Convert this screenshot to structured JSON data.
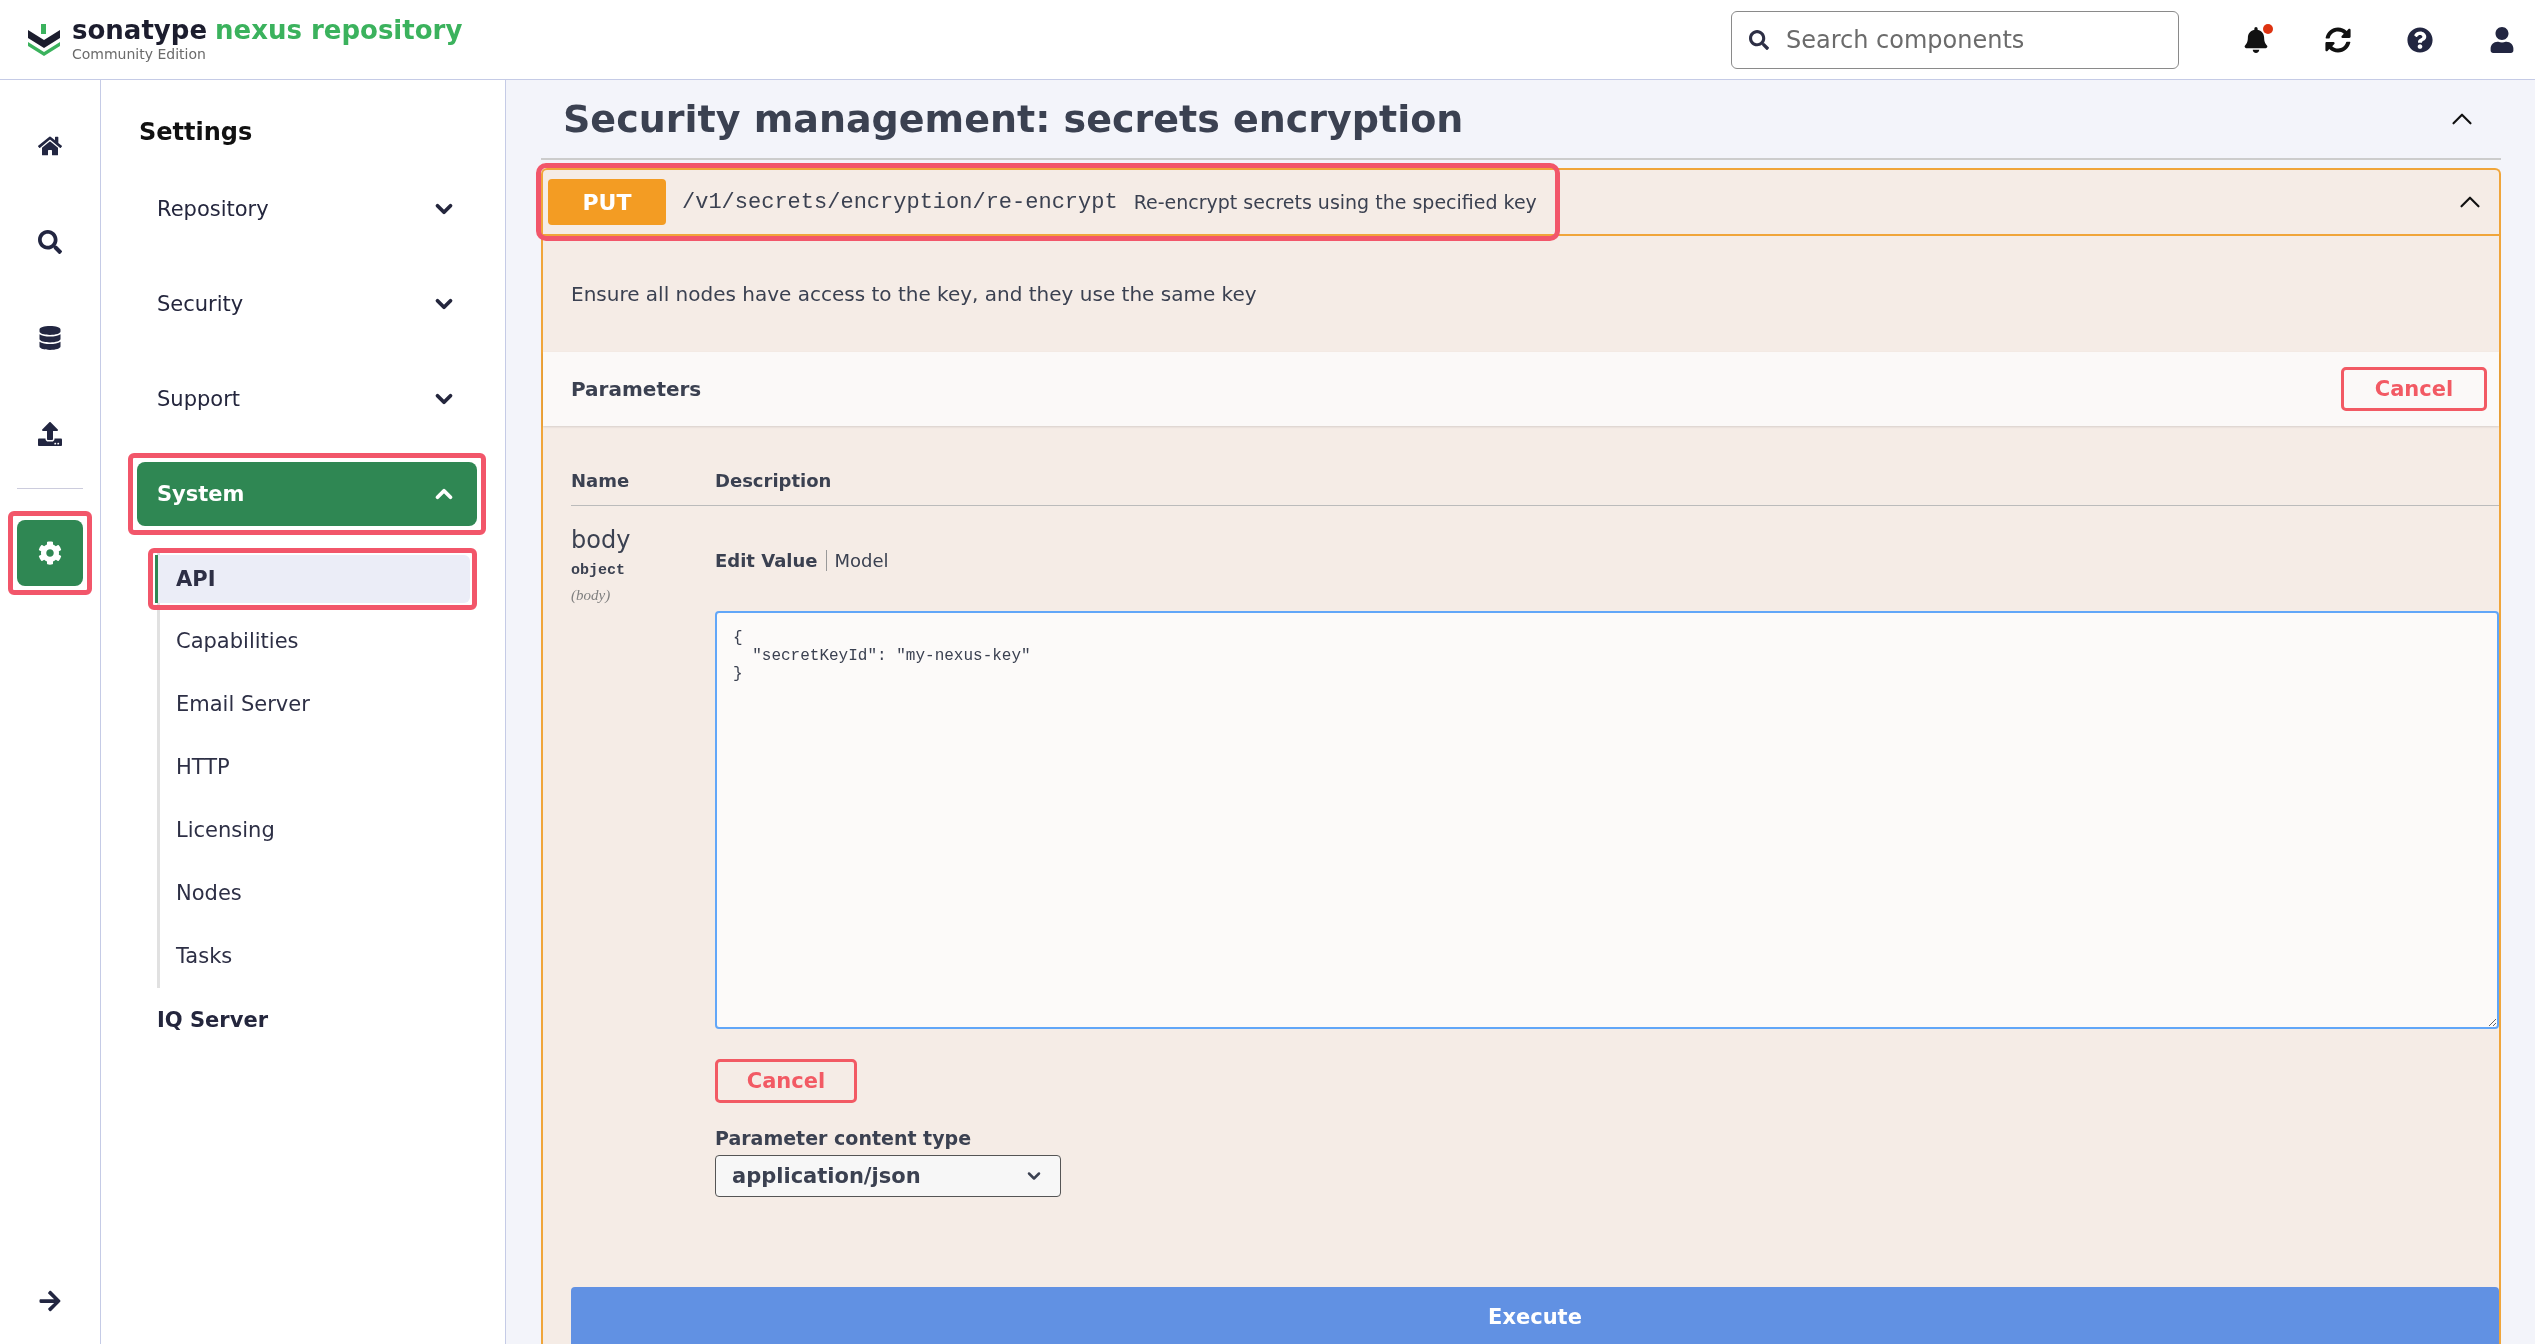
{
  "header": {
    "brand": "sonatype",
    "product": "nexus repository",
    "edition": "Community Edition",
    "search": {
      "placeholder": "Search components"
    },
    "notification_dot": true
  },
  "rail": [
    {
      "kind": "home",
      "selected": false,
      "highlighted": false
    },
    {
      "kind": "search",
      "selected": false,
      "highlighted": false
    },
    {
      "kind": "database",
      "selected": false,
      "highlighted": false
    },
    {
      "kind": "upload",
      "selected": false,
      "highlighted": false
    },
    {
      "kind": "settings",
      "selected": true,
      "highlighted": true
    }
  ],
  "sidebar": {
    "title": "Settings",
    "sections": [
      {
        "kind": "group",
        "label": "Repository",
        "expanded": false,
        "selected": false,
        "highlighted": false
      },
      {
        "kind": "group",
        "label": "Security",
        "expanded": false,
        "selected": false,
        "highlighted": false
      },
      {
        "kind": "group",
        "label": "Support",
        "expanded": false,
        "selected": false,
        "highlighted": false
      },
      {
        "kind": "group",
        "label": "System",
        "expanded": true,
        "selected": true,
        "highlighted": true,
        "children": [
          {
            "label": "API",
            "selected": true,
            "highlighted": true
          },
          {
            "label": "Capabilities",
            "selected": false,
            "highlighted": false
          },
          {
            "label": "Email Server",
            "selected": false,
            "highlighted": false
          },
          {
            "label": "HTTP",
            "selected": false,
            "highlighted": false
          },
          {
            "label": "Licensing",
            "selected": false,
            "highlighted": false
          },
          {
            "label": "Nodes",
            "selected": false,
            "highlighted": false
          },
          {
            "label": "Tasks",
            "selected": false,
            "highlighted": false
          }
        ]
      },
      {
        "kind": "link",
        "label": "IQ Server",
        "selected": false
      }
    ]
  },
  "main": {
    "title": "Security management: secrets encryption",
    "expanded": true,
    "operation": {
      "method": "PUT",
      "path": "/v1/secrets/encryption/re-encrypt",
      "summary": "Re-encrypt secrets using the specified key",
      "highlighted": true,
      "expanded": true,
      "description": "Ensure all nodes have access to the key, and they use the same key",
      "parameters_title": "Parameters",
      "header_cancel": "Cancel",
      "columns": [
        "Name",
        "Description"
      ],
      "param": {
        "name": "body",
        "type": "object",
        "location": "(body)"
      },
      "tabs": [
        {
          "label": "Edit Value",
          "selected": true
        },
        {
          "label": "Model",
          "selected": false
        }
      ],
      "value": "{\n  \"secretKeyId\": \"my-nexus-key\"\n}",
      "cancel": "Cancel",
      "content_type_label": "Parameter content type",
      "content_type": "application/json",
      "execute": "Execute"
    }
  }
}
